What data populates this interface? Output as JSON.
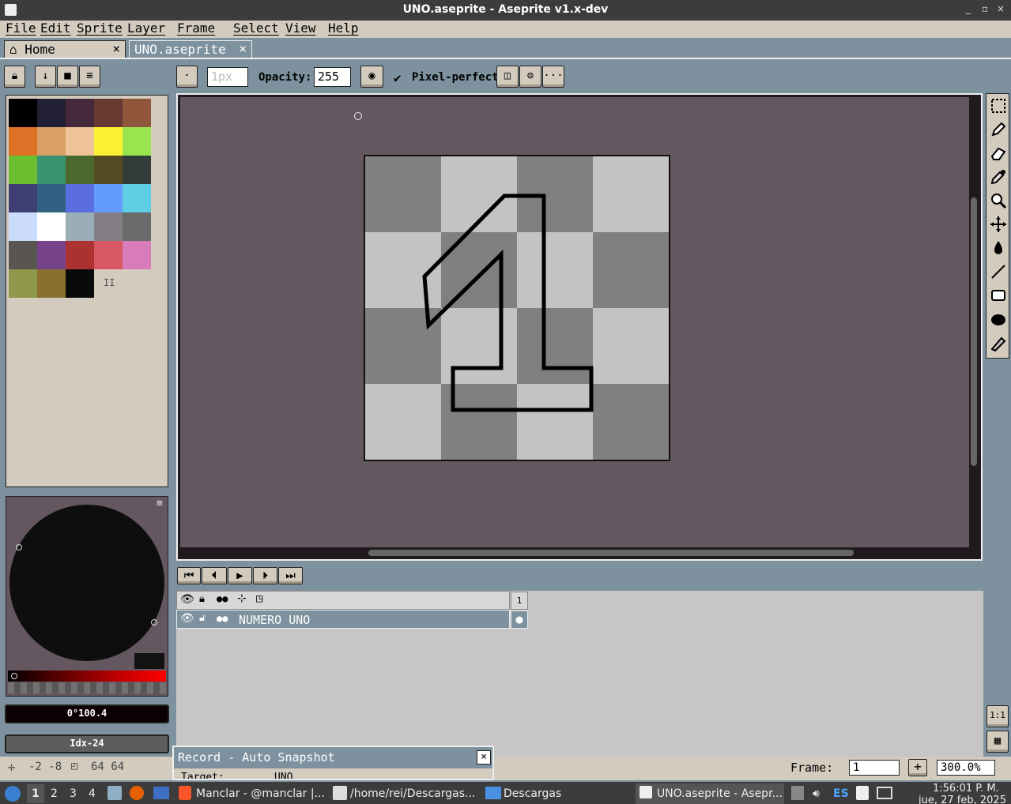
{
  "window": {
    "title": "UNO.aseprite - Aseprite v1.x-dev",
    "min": "_",
    "restore": "▫",
    "close": "×"
  },
  "menu": [
    "File",
    "Edit",
    "Sprite",
    "Layer",
    "Frame",
    "Select",
    "View",
    "Help"
  ],
  "tabs": [
    {
      "label": "Home",
      "close": "×"
    },
    {
      "label": "UNO.aseprite",
      "close": "×"
    }
  ],
  "toolbar": {
    "brush_size": "1px",
    "opacity_label": "Opacity:",
    "opacity_value": "255",
    "pixel_perfect_label": "Pixel-perfect",
    "pixel_perfect_checked": true,
    "more": "···"
  },
  "palette": {
    "colors": [
      "#000000",
      "#222034",
      "#45283c",
      "#663931",
      "#8f563b",
      "#df7126",
      "#d9a066",
      "#eec39a",
      "#fbf236",
      "#99e550",
      "#6abe30",
      "#37946e",
      "#4b692f",
      "#524b24",
      "#323c39",
      "#3f3f74",
      "#306082",
      "#5b6ee1",
      "#639bff",
      "#5fcde4",
      "#cbdbfc",
      "#ffffff",
      "#9badb7",
      "#847e87",
      "#696a6a",
      "#595652",
      "#76428a",
      "#ac3232",
      "#d95763",
      "#d77bba",
      "#8f974a",
      "#8a6f30",
      "#0a0a0a"
    ],
    "pause_glyph": "II"
  },
  "color_info": {
    "fg_value": "0°100.4",
    "index_value": "Idx-24"
  },
  "timeline": {
    "frames": [
      "1"
    ],
    "layers": [
      {
        "name": "NUMERO UNO"
      }
    ]
  },
  "status": {
    "cursor_pos": "-2 -8",
    "sprite_size": "64 64",
    "frame_label": "Frame:",
    "frame_value": "1",
    "zoom": "300.0%"
  },
  "record_panel": {
    "title": "Record - Auto Snapshot",
    "target_label": "Target:",
    "target_value": "UNO",
    "close": "×"
  },
  "taskbar": {
    "workspaces": [
      "1",
      "2",
      "3",
      "4"
    ],
    "items": [
      "Manclar - @manclar |...",
      "/home/rei/Descargas...",
      "Descargas",
      "UNO.aseprite - Asepr..."
    ],
    "lang": "ES",
    "time": "1:56:01 P. M.",
    "date": "jue, 27 feb, 2025"
  }
}
